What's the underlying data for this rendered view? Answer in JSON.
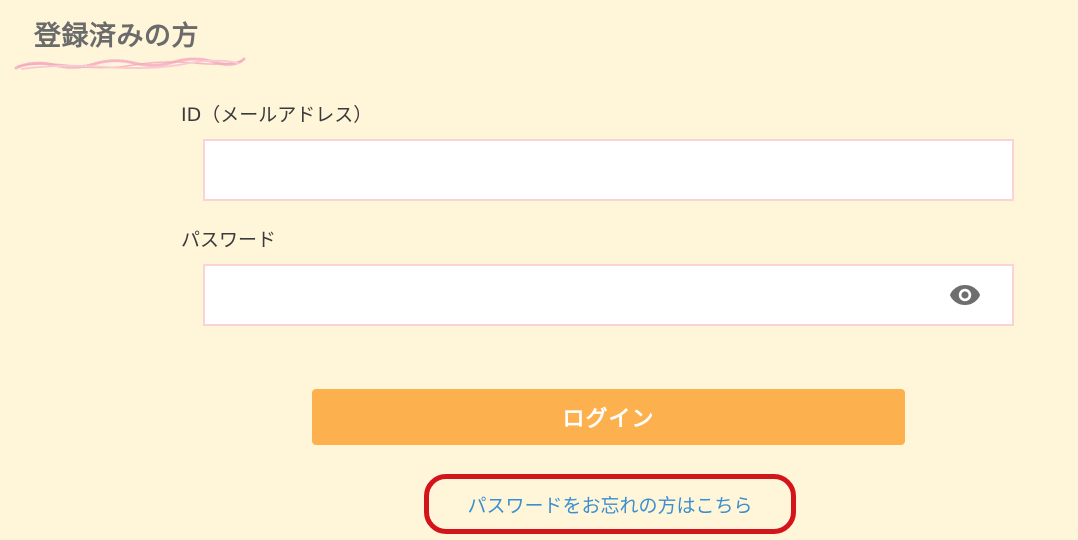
{
  "section": {
    "title": "登録済みの方"
  },
  "form": {
    "id_label": "ID（メールアドレス）",
    "id_value": "",
    "password_label": "パスワード",
    "password_value": "",
    "password_toggle_icon": "eye-icon"
  },
  "actions": {
    "login_label": "ログイン",
    "forgot_password_label": "パスワードをお忘れの方はこちら"
  },
  "colors": {
    "background": "#fff6da",
    "input_border": "#fbd2d6",
    "login_button": "#fdb04e",
    "link": "#3b8fcf",
    "highlight_outline": "#d3141b"
  }
}
